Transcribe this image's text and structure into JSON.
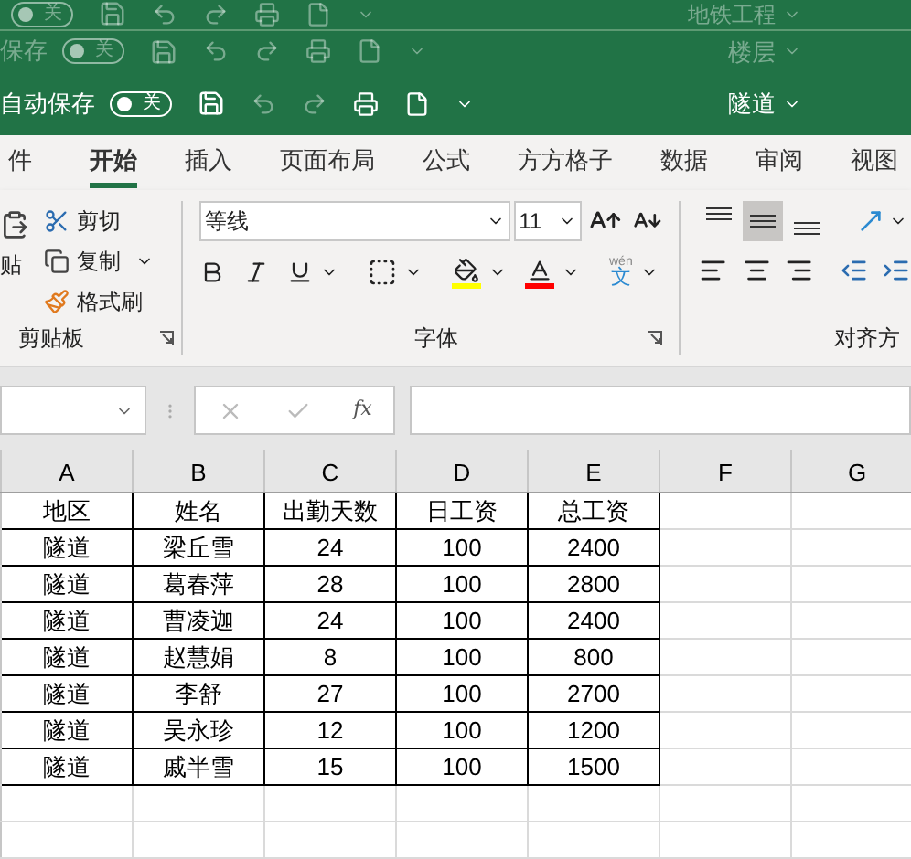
{
  "title_bars": [
    {
      "toggle": "关",
      "on": false,
      "document": "地铁工程",
      "active": false
    },
    {
      "autosave_label": "保存",
      "toggle": "关",
      "on": false,
      "document": "楼层",
      "active": false
    },
    {
      "autosave_label": "自动保存",
      "toggle": "关",
      "on": false,
      "document": "隧道",
      "active": true
    }
  ],
  "tabs": [
    {
      "label": "件",
      "selected": false
    },
    {
      "label": "开始",
      "selected": true
    },
    {
      "label": "插入",
      "selected": false
    },
    {
      "label": "页面布局",
      "selected": false
    },
    {
      "label": "公式",
      "selected": false
    },
    {
      "label": "方方格子",
      "selected": false
    },
    {
      "label": "数据",
      "selected": false
    },
    {
      "label": "审阅",
      "selected": false
    },
    {
      "label": "视图",
      "selected": false
    }
  ],
  "ribbon": {
    "clipboard": {
      "paste": "贴",
      "cut": "剪切",
      "copy": "复制",
      "format_painter": "格式刷",
      "label": "剪贴板"
    },
    "font": {
      "name": "等线",
      "size": "11",
      "phonetic_top": "wén",
      "phonetic": "文",
      "label": "字体"
    },
    "alignment": {
      "vertical_buttons": [
        {
          "kind": "top",
          "selected": false
        },
        {
          "kind": "middle",
          "selected": true
        },
        {
          "kind": "bottom",
          "selected": false
        }
      ],
      "label": "对齐方"
    }
  },
  "formula_bar": {
    "fx": "fx"
  },
  "sheet": {
    "columns": [
      "A",
      "B",
      "C",
      "D",
      "E",
      "F",
      "G"
    ],
    "rows": [
      [
        "地区",
        "姓名",
        "出勤天数",
        "日工资",
        "总工资"
      ],
      [
        "隧道",
        "梁丘雪",
        "24",
        "100",
        "2400"
      ],
      [
        "隧道",
        "葛春萍",
        "28",
        "100",
        "2800"
      ],
      [
        "隧道",
        "曹凌迦",
        "24",
        "100",
        "2400"
      ],
      [
        "隧道",
        "赵慧娟",
        "8",
        "100",
        "800"
      ],
      [
        "隧道",
        "李舒",
        "27",
        "100",
        "2700"
      ],
      [
        "隧道",
        "吴永珍",
        "12",
        "100",
        "1200"
      ],
      [
        "隧道",
        "戚半雪",
        "15",
        "100",
        "1500"
      ]
    ]
  }
}
